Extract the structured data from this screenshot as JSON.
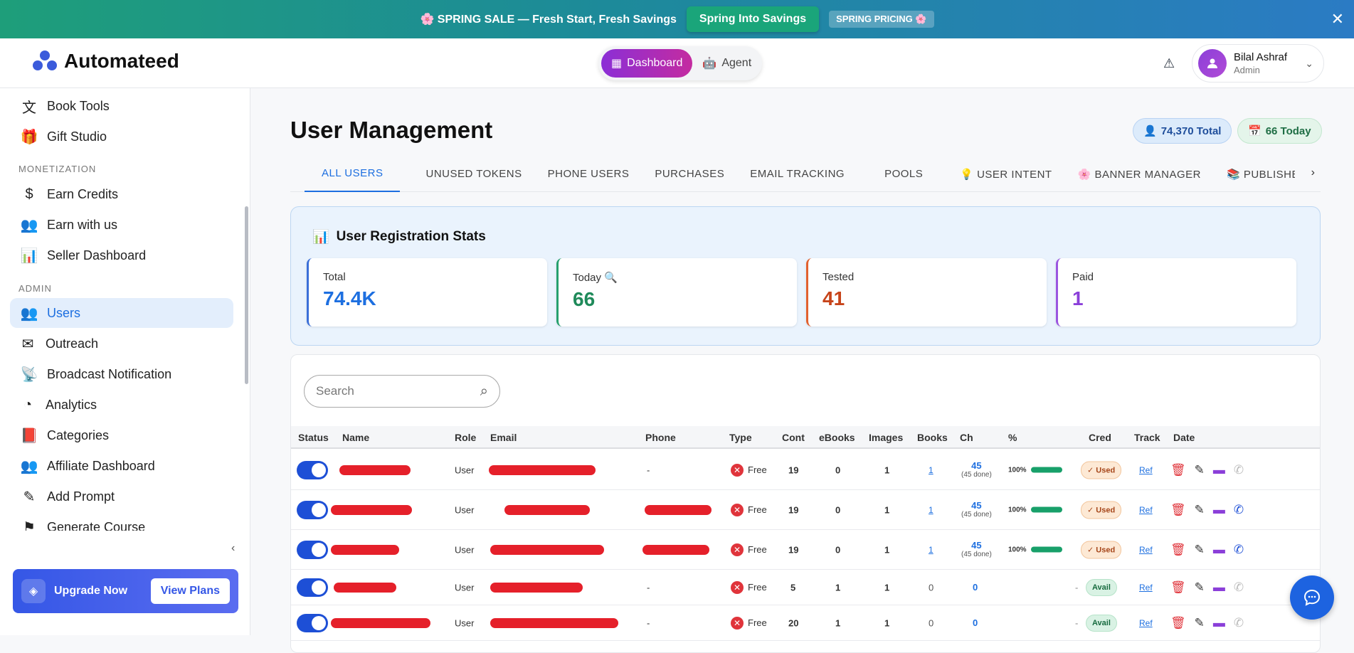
{
  "banner": {
    "text": "🌸 SPRING SALE — Fresh Start, Fresh Savings",
    "cta": "Spring Into Savings",
    "tag": "SPRING PRICING 🌸",
    "close": "✕"
  },
  "header": {
    "brand": "Automateed",
    "tabs": [
      "Dashboard",
      "Agent"
    ],
    "user_name": "Bilal Ashraf",
    "user_role": "Admin"
  },
  "sidebar": {
    "items_top": [
      {
        "label": "Book Tools",
        "icon": "translate-icon"
      },
      {
        "label": "Gift Studio",
        "icon": "gift-icon"
      }
    ],
    "section_monetization": "MONETIZATION",
    "items_monetization": [
      {
        "label": "Earn Credits"
      },
      {
        "label": "Earn with us"
      },
      {
        "label": "Seller Dashboard"
      }
    ],
    "section_admin": "ADMIN",
    "items_admin": [
      {
        "label": "Users"
      },
      {
        "label": "Outreach"
      },
      {
        "label": "Broadcast Notification"
      },
      {
        "label": "Analytics"
      },
      {
        "label": "Categories"
      },
      {
        "label": "Affiliate Dashboard"
      },
      {
        "label": "Add Prompt"
      },
      {
        "label": "Generate Course"
      }
    ],
    "upgrade_label": "Upgrade Now",
    "plans_label": "View Plans"
  },
  "main": {
    "title": "User Management",
    "total_pill": "74,370 Total",
    "today_pill": "66 Today",
    "tabs": [
      "ALL USERS",
      "UNUSED TOKENS",
      "PHONE USERS",
      "PURCHASES",
      "EMAIL TRACKING",
      "POOLS",
      "💡 USER INTENT",
      "🌸 BANNER MANAGER",
      "📚 PUBLISHEF"
    ],
    "stats_title": "User Registration Stats",
    "stats": [
      {
        "label": "Total",
        "value": "74.4K",
        "color": "#1d6fe0",
        "border": "#3b6fd8"
      },
      {
        "label": "Today 🔍",
        "value": "66",
        "color": "#1f8a5a",
        "border": "#26a06e"
      },
      {
        "label": "Tested",
        "value": "41",
        "color": "#c7441a",
        "border": "#e2612f"
      },
      {
        "label": "Paid",
        "value": "1",
        "color": "#8b3fd9",
        "border": "#9b55e0"
      }
    ],
    "search_placeholder": "Search",
    "columns": [
      "Status",
      "Name",
      "Role",
      "Email",
      "Phone",
      "Type",
      "Cont",
      "eBooks",
      "Images",
      "Books",
      "Ch",
      "%",
      "Cred",
      "Track",
      "Date"
    ],
    "rows": [
      {
        "role": "User",
        "phone": "-",
        "type": "Free",
        "cont": "19",
        "ebooks": "0",
        "images": "1",
        "books": "1",
        "ch": "45",
        "ch_sub": "(45 done)",
        "pct": "100%",
        "cred": "✓ Used",
        "track": "Ref"
      },
      {
        "role": "User",
        "phone": "",
        "type": "Free",
        "cont": "19",
        "ebooks": "0",
        "images": "1",
        "books": "1",
        "ch": "45",
        "ch_sub": "(45 done)",
        "pct": "100%",
        "cred": "✓ Used",
        "track": "Ref"
      },
      {
        "role": "User",
        "phone": "",
        "type": "Free",
        "cont": "19",
        "ebooks": "0",
        "images": "1",
        "books": "1",
        "ch": "45",
        "ch_sub": "(45 done)",
        "pct": "100%",
        "cred": "✓ Used",
        "track": "Ref"
      },
      {
        "role": "User",
        "phone": "-",
        "type": "Free",
        "cont": "5",
        "ebooks": "1",
        "images": "1",
        "books": "0",
        "ch": "0",
        "ch_sub": "",
        "pct": "-",
        "cred": "Avail",
        "track": "Ref"
      },
      {
        "role": "User",
        "phone": "-",
        "type": "Free",
        "cont": "20",
        "ebooks": "1",
        "images": "1",
        "books": "0",
        "ch": "0",
        "ch_sub": "",
        "pct": "-",
        "cred": "Avail",
        "track": "Ref"
      }
    ]
  }
}
